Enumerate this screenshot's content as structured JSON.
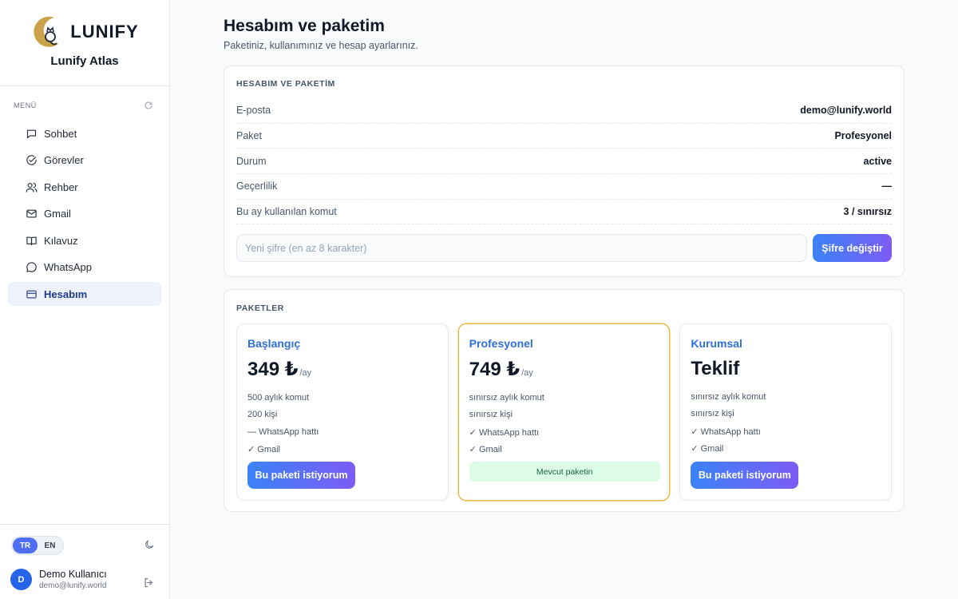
{
  "brand": {
    "logo_text": "LUNIFY",
    "name": "Lunify Atlas"
  },
  "sidebar": {
    "menu_label": "MENÜ",
    "items": [
      {
        "label": "Sohbet",
        "icon": "chat-icon",
        "active": false
      },
      {
        "label": "Görevler",
        "icon": "check-circle-icon",
        "active": false
      },
      {
        "label": "Rehber",
        "icon": "users-icon",
        "active": false
      },
      {
        "label": "Gmail",
        "icon": "mail-icon",
        "active": false
      },
      {
        "label": "Kılavuz",
        "icon": "book-icon",
        "active": false
      },
      {
        "label": "WhatsApp",
        "icon": "whatsapp-icon",
        "active": false
      },
      {
        "label": "Hesabım",
        "icon": "card-icon",
        "active": true
      }
    ],
    "lang": {
      "tr": "TR",
      "en": "EN",
      "selected": "TR"
    },
    "user": {
      "initial": "D",
      "name": "Demo Kullanıcı",
      "email": "demo@lunify.world"
    }
  },
  "page": {
    "title": "Hesabım ve paketim",
    "subtitle": "Paketiniz, kullanımınız ve hesap ayarlarınız."
  },
  "account": {
    "heading": "HESABIM VE PAKETİM",
    "rows": [
      {
        "label": "E-posta",
        "value": "demo@lunify.world"
      },
      {
        "label": "Paket",
        "value": "Profesyonel"
      },
      {
        "label": "Durum",
        "value": "active"
      },
      {
        "label": "Geçerlilik",
        "value": "—"
      },
      {
        "label": "Bu ay kullanılan komut",
        "value": "3 / sınırsız"
      }
    ],
    "password_placeholder": "Yeni şifre (en az 8 karakter)",
    "password_value": "",
    "change_password_label": "Şifre değiştir"
  },
  "plans": {
    "heading": "PAKETLER",
    "items": [
      {
        "name": "Başlangıç",
        "price": "349 ₺",
        "per": "/ay",
        "features": [
          "500 aylık komut",
          "200 kişi",
          "— WhatsApp hattı",
          "✓ Gmail"
        ],
        "cta": "Bu paketi istiyorum",
        "current": false
      },
      {
        "name": "Profesyonel",
        "price": "749 ₺",
        "per": "/ay",
        "features": [
          "sınırsız aylık komut",
          "sınırsız kişi",
          "✓ WhatsApp hattı",
          "✓ Gmail"
        ],
        "cta": "Mevcut paketin",
        "current": true
      },
      {
        "name": "Kurumsal",
        "price": "Teklif",
        "per": "",
        "features": [
          "sınırsız aylık komut",
          "sınırsız kişi",
          "✓ WhatsApp hattı",
          "✓ Gmail"
        ],
        "cta": "Bu paketi istiyorum",
        "current": false
      }
    ]
  },
  "colors": {
    "accent": "#4f6ef7",
    "gradient_start": "#3b82f6",
    "gradient_end": "#7c5cf5",
    "current_border": "#e8b83f",
    "current_badge_bg": "#dcfce7"
  }
}
